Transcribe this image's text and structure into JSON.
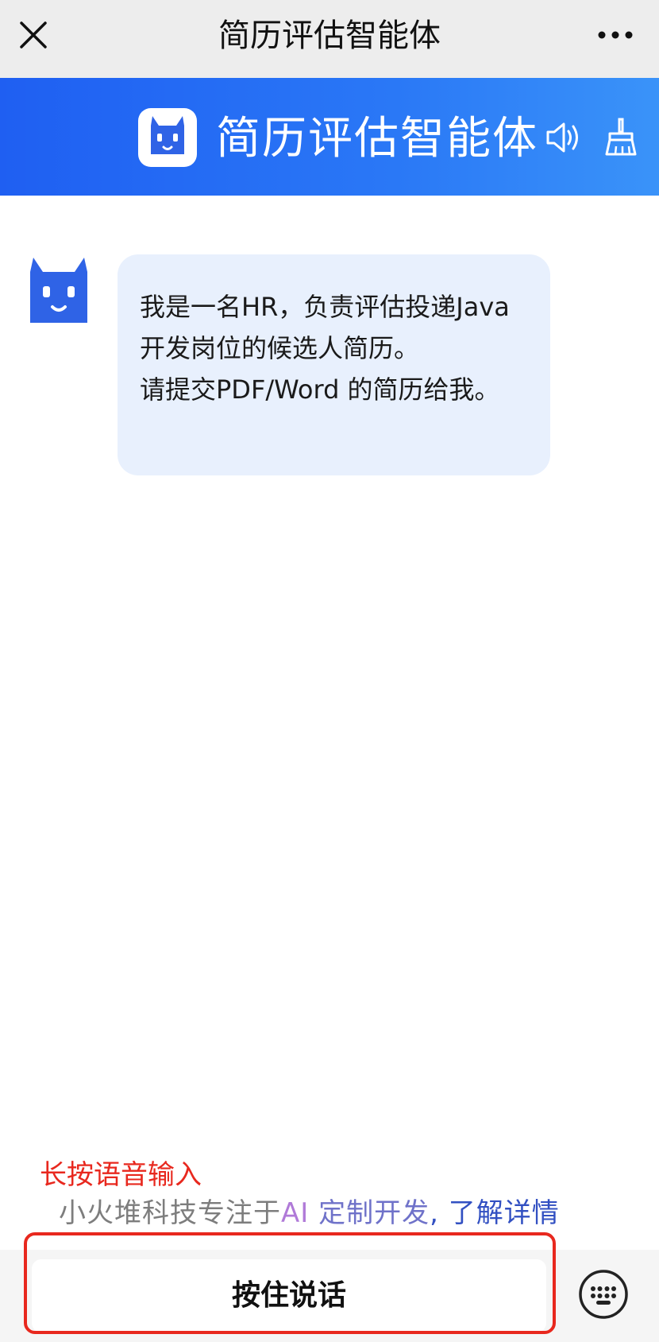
{
  "topbar": {
    "title": "简历评估智能体",
    "close_icon": "close-icon",
    "more_icon": "more-icon"
  },
  "banner": {
    "title": "简历评估智能体",
    "logo_icon": "robot-logo-icon",
    "speaker_icon": "speaker-icon",
    "clear_icon": "broom-icon",
    "color_start": "#1f5ff2",
    "color_end": "#3a93f9"
  },
  "chat": {
    "messages": [
      {
        "role": "bot",
        "text": "我是一名HR，负责评估投递Java开发岗位的候选人简历。\n请提交PDF/Word 的简历给我。"
      }
    ]
  },
  "hint": {
    "long_press": "长按语音输入"
  },
  "promo": {
    "part1": "小火堆科技专注于",
    "part2": "AI ",
    "part3": "定制开发",
    "part4": ", 了解详情"
  },
  "input": {
    "talk_label": "按住说话",
    "keyboard_icon": "keyboard-icon"
  },
  "colors": {
    "accent": "#2a78f6",
    "bubble": "#e8f0fd",
    "highlight": "#e8281e"
  }
}
